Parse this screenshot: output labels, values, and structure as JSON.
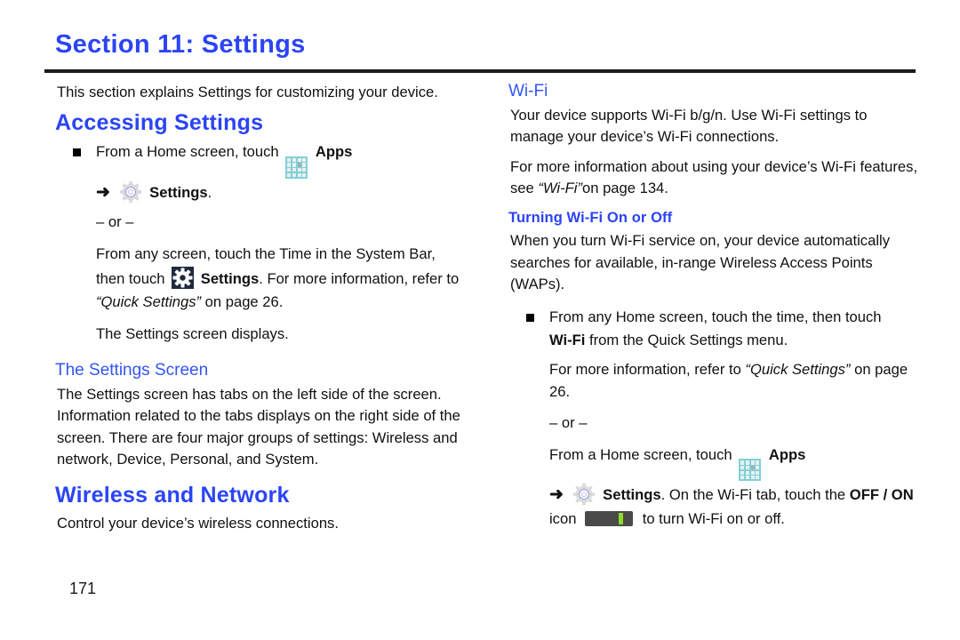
{
  "document": {
    "section_title": "Section 11: Settings",
    "page_number": "171",
    "accent_blue": "#2b44f5",
    "heading_blue": "#3355f2",
    "apps_icon_color": "#7fd2d4",
    "gear_tile_color": "#1f2b3d",
    "toggle_track_color": "#4a4a4a",
    "toggle_indicator_color": "#8ddb2a"
  },
  "left_column": {
    "intro": "This section explains Settings for customizing your device.",
    "accessing_settings": {
      "heading": "Accessing Settings",
      "bullet": {
        "line1_pre": "From a Home screen, touch",
        "apps_icon": "apps-grid-icon",
        "apps_label": "Apps",
        "line2_arrow": "➜",
        "settings_icon": "settings-gear-icon",
        "settings_label": "Settings",
        "settings_period": ".",
        "or_divider": "– or –",
        "alt_line1": "From any screen, touch the Time in the System Bar,",
        "alt_line2_pre": "then touch",
        "quick_settings_icon": "quick-settings-gear-icon",
        "alt_line2_bold": "Settings",
        "alt_line2_post": ". For more information, refer to",
        "alt_line3_italic": "“Quick Settings”",
        "alt_line3_post": "on page 26.",
        "result": "The Settings screen displays."
      }
    },
    "the_settings_screen": {
      "heading": "The Settings Screen",
      "body": "The Settings screen has tabs on the left side of the screen. Information related to the tabs displays on the right side of the screen. There are four major groups of settings: Wireless and network, Device, Personal, and System."
    },
    "wireless_and_network": {
      "heading": "Wireless and Network",
      "body": "Control your device’s wireless connections."
    }
  },
  "right_column": {
    "wifi": {
      "heading": "Wi-Fi",
      "para1": "Your device supports Wi-Fi b/g/n. Use Wi-Fi settings to manage your device’s Wi-Fi connections.",
      "para2_pre": "For more information about using your device’s Wi-Fi features, see",
      "para2_italic": "“Wi-Fi”",
      "para2_post": "on page 134."
    },
    "turning_wifi": {
      "heading": "Turning Wi-Fi On or Off",
      "para1": "When you turn Wi-Fi service on, your device automatically searches for available, in-range Wireless Access Points (WAPs).",
      "bullet": {
        "line1": "From any Home screen, touch the time, then touch",
        "line2_bold": "Wi-Fi",
        "line2_post": "from the Quick Settings menu.",
        "line3_pre": "For more information, refer to",
        "line3_italic": "“Quick Settings”",
        "line3_post": "on page 26.",
        "or_divider": "– or –",
        "alt_line1_pre": "From a Home screen, touch",
        "apps_icon": "apps-grid-icon",
        "apps_label": "Apps",
        "alt_line2_arrow": "➜",
        "settings_icon": "settings-gear-icon",
        "settings_bold": "Settings",
        "alt_line2_mid": ". On the Wi-Fi tab, touch the",
        "offon_bold": "OFF / ON",
        "alt_line3_pre": "icon",
        "toggle_icon": "wifi-toggle-icon",
        "alt_line3_post": "to turn Wi-Fi on or off."
      }
    }
  }
}
